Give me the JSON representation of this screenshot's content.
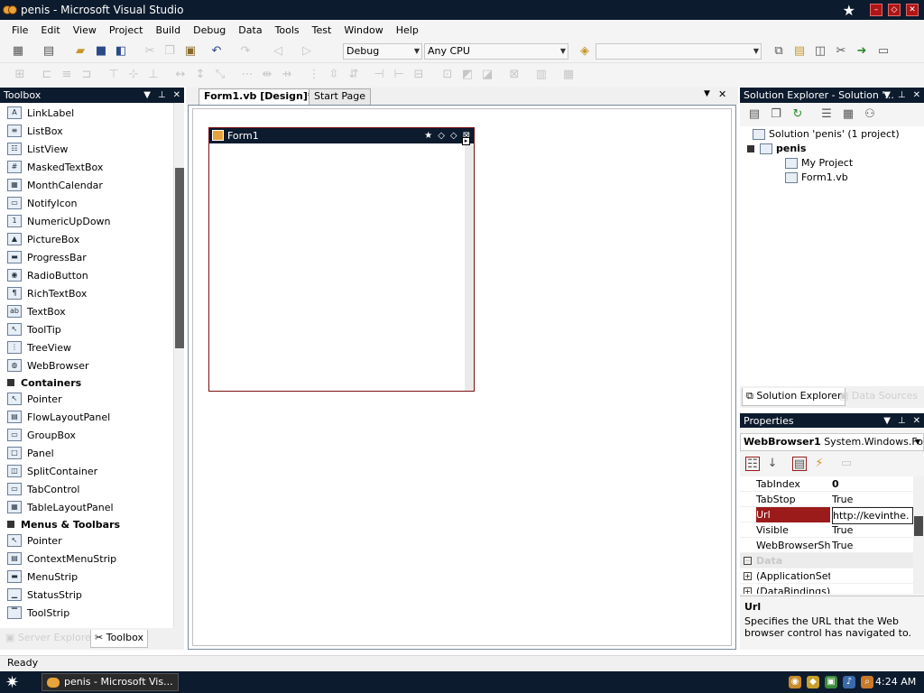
{
  "window": {
    "title": "penis - Microsoft Visual Studio"
  },
  "menubar": [
    "File",
    "Edit",
    "View",
    "Project",
    "Build",
    "Debug",
    "Data",
    "Tools",
    "Test",
    "Window",
    "Help"
  ],
  "toolbar": {
    "config": "Debug",
    "platform": "Any CPU",
    "find_value": ""
  },
  "toolbox": {
    "title": "Toolbox",
    "items_common": [
      "LinkLabel",
      "ListBox",
      "ListView",
      "MaskedTextBox",
      "MonthCalendar",
      "NotifyIcon",
      "NumericUpDown",
      "PictureBox",
      "ProgressBar",
      "RadioButton",
      "RichTextBox",
      "TextBox",
      "ToolTip",
      "TreeView",
      "WebBrowser"
    ],
    "category_containers": "Containers",
    "items_containers": [
      "Pointer",
      "FlowLayoutPanel",
      "GroupBox",
      "Panel",
      "SplitContainer",
      "TabControl",
      "TableLayoutPanel"
    ],
    "category_menus": "Menus & Toolbars",
    "items_menus": [
      "Pointer",
      "ContextMenuStrip",
      "MenuStrip",
      "StatusStrip",
      "ToolStrip"
    ],
    "bottom_tabs": [
      "Server Explorer",
      "Toolbox"
    ]
  },
  "document": {
    "tabs": [
      "Form1.vb [Design]*",
      "Start Page"
    ],
    "form_title": "Form1"
  },
  "solution_explorer": {
    "title": "Solution Explorer - Solution '...",
    "root": "Solution 'penis' (1 project)",
    "project": "penis",
    "children": [
      "My Project",
      "Form1.vb"
    ],
    "bottom_tabs": [
      "Solution Explorer",
      "Data Sources"
    ]
  },
  "properties": {
    "title": "Properties",
    "object_name": "WebBrowser1",
    "object_type": "System.Windows.Fo",
    "rows": [
      {
        "name": "TabIndex",
        "value": "0"
      },
      {
        "name": "TabStop",
        "value": "True"
      },
      {
        "name": "Url",
        "value": "http://kevinthe."
      },
      {
        "name": "Visible",
        "value": "True"
      },
      {
        "name": "WebBrowserSho",
        "value": "True"
      }
    ],
    "category_data": "Data",
    "expand_rows": [
      "(ApplicationSetti",
      "(DataBindings)"
    ],
    "desc_name": "Url",
    "desc_text": "Specifies the URL that the Web browser control has navigated to."
  },
  "status": "Ready",
  "taskbar": {
    "task": "penis - Microsoft Vis...",
    "clock": "4:24 AM"
  },
  "colors": {
    "titlebar": "#0d1b2e",
    "selection": "#9b1b1b",
    "accent_green": "#2aa32a"
  }
}
